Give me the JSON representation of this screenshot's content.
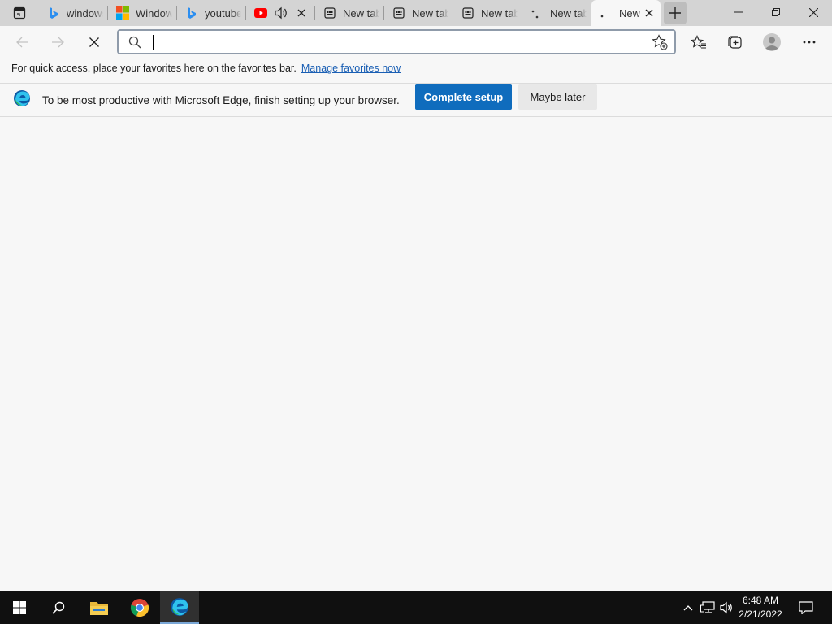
{
  "browser": {
    "tabs": [
      {
        "title": "windows",
        "favicon": "bing-icon"
      },
      {
        "title": "Windows",
        "favicon": "microsoft-logo-icon"
      },
      {
        "title": "youtube",
        "favicon": "bing-icon"
      },
      {
        "title": "",
        "favicon": "youtube-icon",
        "audio": "speaker-icon"
      },
      {
        "title": "New tab",
        "favicon": "newtab-icon"
      },
      {
        "title": "New tab",
        "favicon": "newtab-icon"
      },
      {
        "title": "New tab",
        "favicon": "newtab-icon"
      },
      {
        "title": "New tab",
        "favicon": "loading-icon"
      },
      {
        "title": "New",
        "favicon": "loading-icon",
        "active": true
      }
    ],
    "address_bar": {
      "value": "",
      "placeholder": ""
    },
    "favorites_bar": {
      "message": "For quick access, place your favorites here on the favorites bar.",
      "link": "Manage favorites now"
    },
    "infobar": {
      "message": "To be most productive with Microsoft Edge, finish setting up your browser.",
      "primary_button": "Complete setup",
      "secondary_button": "Maybe later"
    },
    "colors": {
      "accent": "#0f6cbd",
      "link": "#1a5fb4",
      "youtube": "#ff0000"
    }
  },
  "taskbar": {
    "apps": [
      "start-icon",
      "search-icon",
      "file-explorer-icon",
      "chrome-icon",
      "edge-icon"
    ],
    "clock": {
      "time": "6:48 AM",
      "date": "2/21/2022"
    }
  }
}
